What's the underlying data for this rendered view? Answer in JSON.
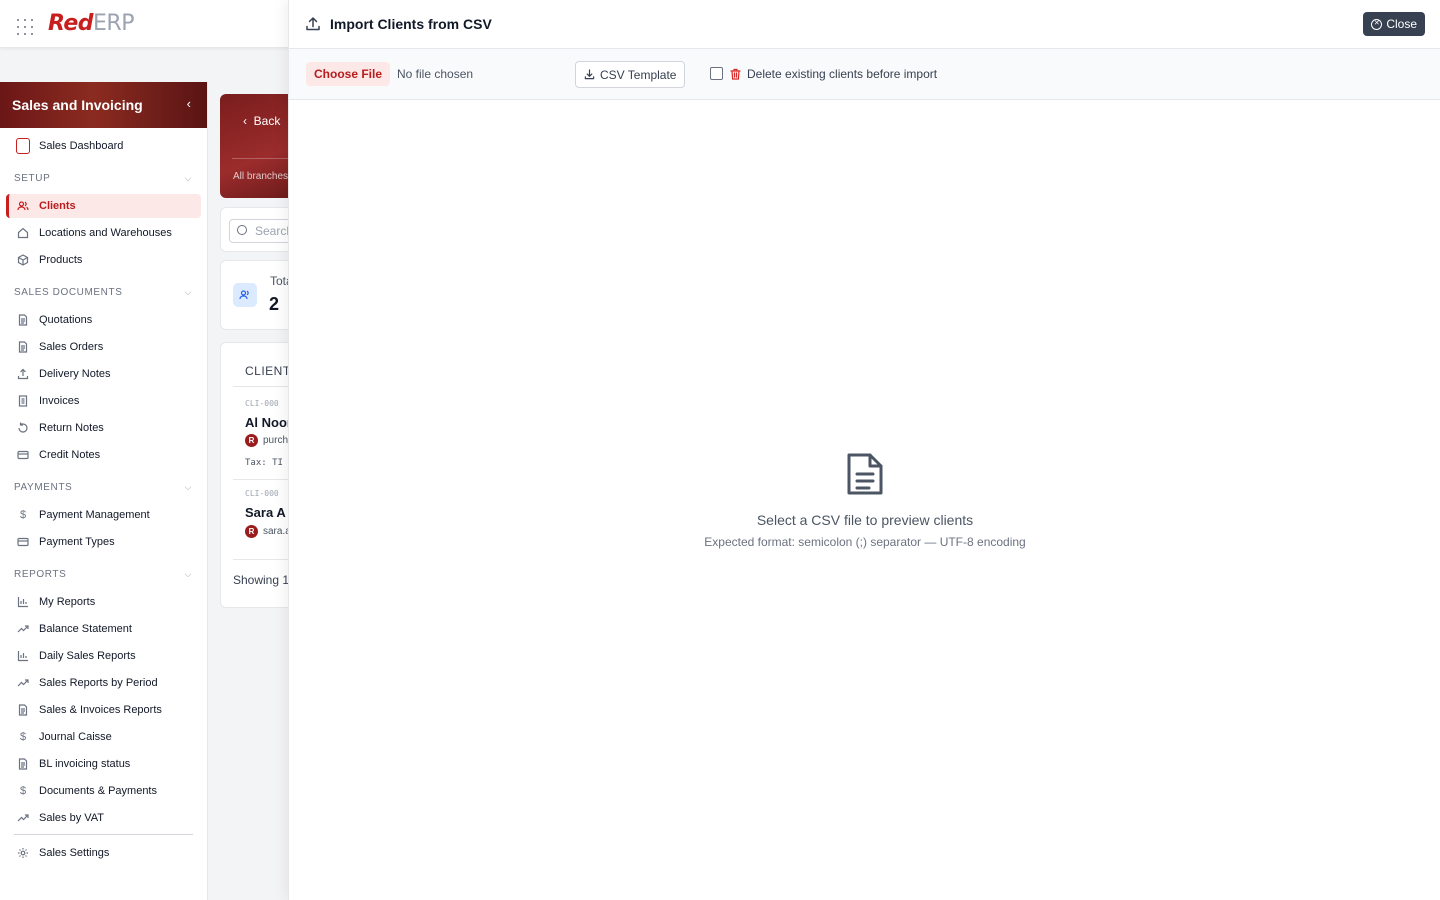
{
  "brand": {
    "logo_red": "Red",
    "logo_gray": "ERP"
  },
  "sidebar": {
    "title": "Sales and Invoicing",
    "dashboard": "Sales Dashboard",
    "sections": {
      "setup": "SETUP",
      "sales_documents": "SALES DOCUMENTS",
      "payments": "PAYMENTS",
      "reports": "REPORTS"
    },
    "setup_items": [
      "Clients",
      "Locations and Warehouses",
      "Products"
    ],
    "sales_document_items": [
      "Quotations",
      "Sales Orders",
      "Delivery Notes",
      "Invoices",
      "Return Notes",
      "Credit Notes"
    ],
    "payment_items": [
      "Payment Management",
      "Payment Types"
    ],
    "report_items": [
      "My Reports",
      "Balance Statement",
      "Daily Sales Reports",
      "Sales Reports by Period",
      "Sales & Invoices Reports",
      "Journal Caisse",
      "BL invoicing status",
      "Documents & Payments",
      "Sales by VAT"
    ],
    "settings": "Sales Settings"
  },
  "background": {
    "back": "Back",
    "hero_sub": "All branches",
    "search_placeholder": "Search",
    "stat_label": "Total",
    "stat_value": "2",
    "list_header": "CLIENTS",
    "clients": [
      {
        "code": "CLI-000",
        "name": "Al Noor",
        "badge": "R",
        "email": "purch",
        "tax": "Tax: TI"
      },
      {
        "code": "CLI-000",
        "name": "Sara A",
        "badge": "R",
        "email": "sara.a"
      }
    ],
    "showing": "Showing 1"
  },
  "modal": {
    "title": "Import Clients from CSV",
    "close": "Close",
    "choose_file": "Choose File",
    "no_file": "No file chosen",
    "csv_template": "CSV Template",
    "delete_existing": "Delete existing clients before import",
    "empty_title": "Select a CSV file to preview clients",
    "empty_sub": "Expected format: semicolon (;) separator — UTF-8 encoding"
  }
}
